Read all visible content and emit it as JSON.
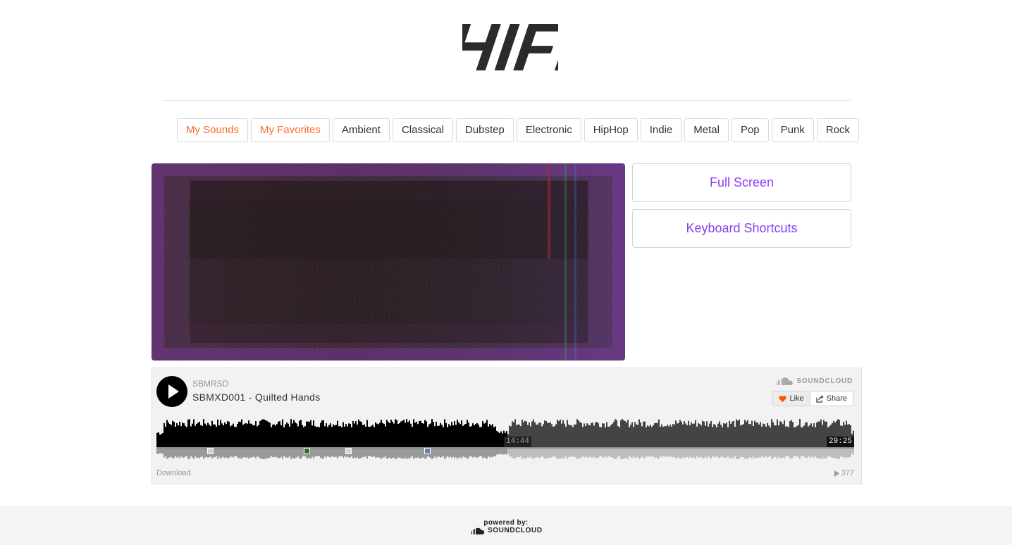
{
  "header": {
    "logo_text": "HIFI"
  },
  "genres": [
    {
      "label": "My Sounds",
      "accent": true
    },
    {
      "label": "My Favorites",
      "accent": true
    },
    {
      "label": "Ambient"
    },
    {
      "label": "Classical"
    },
    {
      "label": "Dubstep"
    },
    {
      "label": "Electronic"
    },
    {
      "label": "HipHop"
    },
    {
      "label": "Indie"
    },
    {
      "label": "Metal"
    },
    {
      "label": "Pop"
    },
    {
      "label": "Punk"
    },
    {
      "label": "Rock"
    }
  ],
  "controls": {
    "fullscreen_label": "Full Screen",
    "shortcuts_label": "Keyboard Shortcuts"
  },
  "player": {
    "artist": "SBMRSD",
    "track_title": "SBMXD001 - Quilted Hands",
    "brand": "SOUNDCLOUD",
    "like_label": "Like",
    "share_label": "Share",
    "elapsed": "14:44",
    "duration": "29:25",
    "progress": 0.502,
    "download_label": "Download",
    "play_count": "377"
  },
  "footer": {
    "powered_by": "powered by:",
    "brand": "SOUNDCLOUD"
  },
  "colors": {
    "accent_orange": "#ff6a2b",
    "accent_purple": "#8a3ff2",
    "waveform_played": "#000000",
    "waveform_remaining": "#444444"
  }
}
